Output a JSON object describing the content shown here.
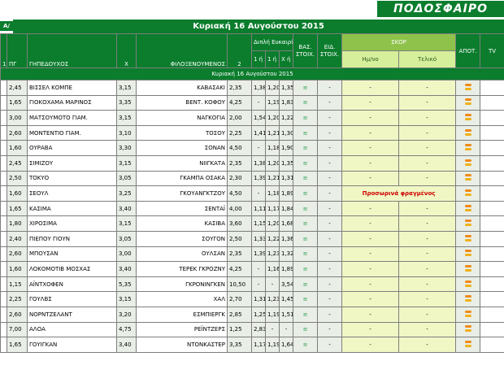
{
  "header": {
    "logo": "ΠΟΔΟΣΦΑΙΡΟ",
    "badge": "Α/",
    "date_title": "Κυριακή 16 Αυγούστου 2015",
    "date_subtitle": "Κυριακή 16 Αυγούστου 2015"
  },
  "columns": {
    "c1": "1",
    "code": "ΠΓ",
    "home": "ΓΗΠΕΔΟΥΧΟΣ",
    "x": "Χ",
    "away": "ΦΙΛΟΞΕΝΟΥΜΕΝΟΣ",
    "two": "2",
    "double_chance": "Διπλή Ευκαιρία",
    "dc1": "1 ή Χ",
    "dc2": "1 ή 2",
    "dc3": "Χ ή 2",
    "bas": "ΒΑΣ. ΣΤΟΙΧ.",
    "eid": "ΕΙΔ. ΣΤΟΙΧ.",
    "score": "ΣΚΟΡ",
    "half": "Ημ/νο",
    "final": "Τελικό",
    "result": "ΑΠΟΤ.",
    "tv": "TV"
  },
  "rows": [
    {
      "o1": "2,45",
      "home": "ΒΙΣΣΕΛ ΚΟΜΠΕ",
      "x": "3,15",
      "away": "ΚΑΒΑΣΑΚΙ",
      "o2": "2,35",
      "a": "1,38",
      "b": "1,20",
      "c": "1,35",
      "bas": "≡",
      "eid": "-",
      "half": "-",
      "final": "-"
    },
    {
      "o1": "1,65",
      "home": "ΓΙΟΚΟΧΑΜΑ ΜΑΡΙΝΟΣ",
      "x": "3,35",
      "away": "ΒΕΝΤ. ΚΟΦΟΥ",
      "o2": "4,25",
      "a": "-",
      "b": "1,19",
      "c": "1,83",
      "bas": "≡",
      "eid": "-",
      "half": "-",
      "final": "-"
    },
    {
      "o1": "3,00",
      "home": "ΜΑΤΣΟΥΜΟΤΟ ΓΙΑΜ.",
      "x": "3,15",
      "away": "ΝΑΓΚΟΓΙΑ",
      "o2": "2,00",
      "a": "1,54",
      "b": "1,20",
      "c": "1,22",
      "bas": "≡",
      "eid": "-",
      "half": "-",
      "final": "-"
    },
    {
      "o1": "2,60",
      "home": "ΜΟΝΤΕΝΤΙΟ ΓΙΑΜ.",
      "x": "3,10",
      "away": "ΤΟΣΟΥ",
      "o2": "2,25",
      "a": "1,41",
      "b": "1,21",
      "c": "1,30",
      "bas": "≡",
      "eid": "-",
      "half": "-",
      "final": "-"
    },
    {
      "o1": "1,60",
      "home": "ΟΥΡΑΒΑ",
      "x": "3,30",
      "away": "ΣΟΝΑΝ",
      "o2": "4,50",
      "a": "-",
      "b": "1,18",
      "c": "1,90",
      "bas": "≡",
      "eid": "-",
      "half": "-",
      "final": "-"
    },
    {
      "o1": "2,45",
      "home": "ΣΙΜΙΖΟΥ",
      "x": "3,15",
      "away": "ΝΙΙΓΚΑΤΑ",
      "o2": "2,35",
      "a": "1,38",
      "b": "1,20",
      "c": "1,35",
      "bas": "≡",
      "eid": "-",
      "half": "-",
      "final": "-"
    },
    {
      "o1": "2,50",
      "home": "ΤΟΚΥΟ",
      "x": "3,05",
      "away": "ΓΚΑΜΠΑ ΟΣΑΚΑ",
      "o2": "2,30",
      "a": "1,39",
      "b": "1,21",
      "c": "1,31",
      "bas": "≡",
      "eid": "-",
      "half": "-",
      "final": "-"
    },
    {
      "o1": "1,60",
      "home": "ΣΕΟΥΛ",
      "x": "3,25",
      "away": "ΓΚΟΥΑΝΓΚΤΖΟΥ",
      "o2": "4,50",
      "a": "-",
      "b": "1,18",
      "c": "1,89",
      "bas": "≡",
      "eid": "-",
      "half": "",
      "final": "",
      "suspended": "Προσωρινά φραγμένος"
    },
    {
      "o1": "1,65",
      "home": "ΚΑΣΙΜΑ",
      "x": "3,40",
      "away": "ΣΕΝΤΑΪ",
      "o2": "4,00",
      "a": "1,11",
      "b": "1,17",
      "c": "1,84",
      "bas": "≡",
      "eid": "-",
      "half": "-",
      "final": "-"
    },
    {
      "o1": "1,80",
      "home": "ΧΙΡΟΣΙΜΑ",
      "x": "3,15",
      "away": "ΚΑΣΙΒΑ",
      "o2": "3,60",
      "a": "1,15",
      "b": "1,20",
      "c": "1,68",
      "bas": "≡",
      "eid": "-",
      "half": "-",
      "final": "-"
    },
    {
      "o1": "2,40",
      "home": "ΠΙΕΠΟΥ ΓΙΟΥΝ",
      "x": "3,05",
      "away": "ΣΟΥΓΟΝ",
      "o2": "2,50",
      "a": "1,33",
      "b": "1,22",
      "c": "1,36",
      "bas": "≡",
      "eid": "-",
      "half": "-",
      "final": "-"
    },
    {
      "o1": "2,60",
      "home": "ΜΠΟΥΣΑΝ",
      "x": "3,00",
      "away": "ΟΥΛΣΑΝ",
      "o2": "2,35",
      "a": "1,39",
      "b": "1,23",
      "c": "1,32",
      "bas": "≡",
      "eid": "-",
      "half": "-",
      "final": "-"
    },
    {
      "o1": "1,60",
      "home": "ΛΟΚΟΜΟΤΙΒ ΜΟΣΧΑΣ",
      "x": "3,40",
      "away": "ΤΕΡΕΚ ΓΚΡΟΖΝΥ",
      "o2": "4,25",
      "a": "-",
      "b": "1,16",
      "c": "1,89",
      "bas": "≡",
      "eid": "-",
      "half": "-",
      "final": "-"
    },
    {
      "o1": "1,15",
      "home": "ΑΪΝΤΧΟΦΕΝ",
      "x": "5,35",
      "away": "ΓΚΡΟΝΙΝΓΚΕΝ",
      "o2": "10,50",
      "a": "-",
      "b": "-",
      "c": "3,54",
      "bas": "≡",
      "eid": "-",
      "half": "-",
      "final": "-"
    },
    {
      "o1": "2,25",
      "home": "ΓΟΥΛΒΣ",
      "x": "3,15",
      "away": "ΧΑΛ",
      "o2": "2,70",
      "a": "1,31",
      "b": "1,23",
      "c": "1,45",
      "bas": "≡",
      "eid": "-",
      "half": "-",
      "final": "-"
    },
    {
      "o1": "2,60",
      "home": "ΝΟΡΝΤΖΕΛΑΝΤ",
      "x": "3,20",
      "away": "ΕΣΜΠΙΕΡΓΚ",
      "o2": "2,85",
      "a": "1,25",
      "b": "1,19",
      "c": "1,51",
      "bas": "≡",
      "eid": "-",
      "half": "-",
      "final": "-"
    },
    {
      "o1": "7,00",
      "home": "ΑΛΟΑ",
      "x": "4,75",
      "away": "ΡΕΪΝΤΖΕΡΣ",
      "o2": "1,25",
      "a": "2,83",
      "b": "-",
      "c": "-",
      "bas": "≡",
      "eid": "-",
      "half": "-",
      "final": "-"
    },
    {
      "o1": "1,65",
      "home": "ΓΟΥΙΓΚΑΝ",
      "x": "3,40",
      "away": "ΝΤΟΝΚΑΣΤΕΡ",
      "o2": "3,35",
      "a": "1,17",
      "b": "1,19",
      "c": "1,64",
      "bas": "≡",
      "eid": "-",
      "half": "-",
      "final": "-"
    }
  ]
}
